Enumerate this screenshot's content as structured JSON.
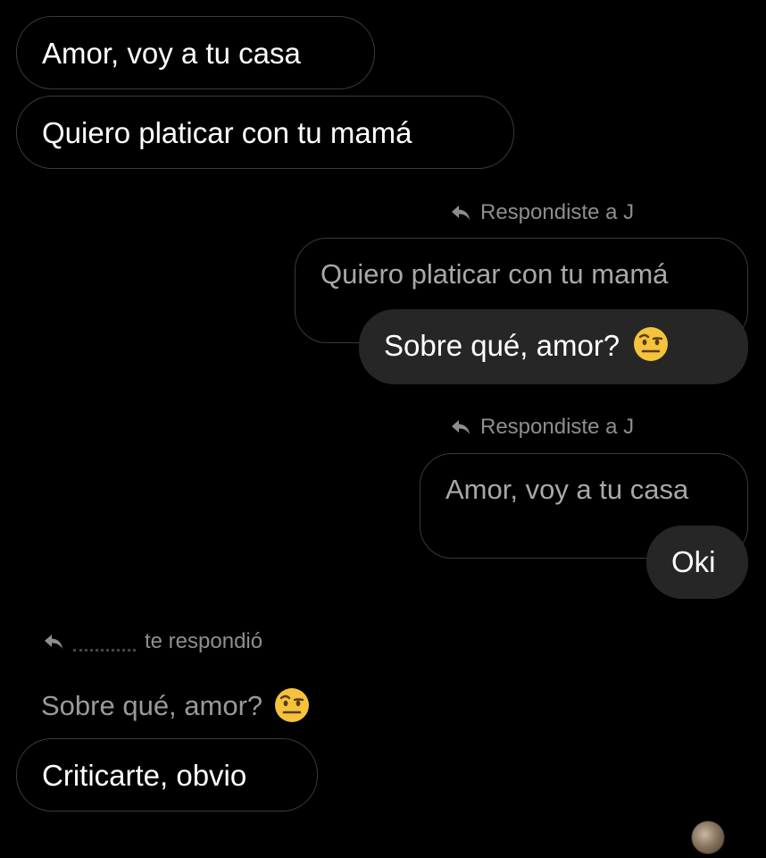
{
  "conversation": {
    "msg1": {
      "text": "Amor, voy a tu casa"
    },
    "msg2": {
      "text": "Quiero platicar con tu mamá"
    },
    "reply1": {
      "label": "Respondiste a J",
      "quoted": "Quiero platicar con tu mamá",
      "text": "Sobre qué, amor?",
      "emoji": "raised-eyebrow-emoji"
    },
    "reply2": {
      "label": "Respondiste a J",
      "quoted": "Amor, voy a tu casa",
      "text": "Oki"
    },
    "reply3": {
      "label": "te respondió",
      "quoted": "Sobre qué, amor?",
      "emoji": "raised-eyebrow-emoji",
      "text": "Criticarte, obvio"
    }
  },
  "colors": {
    "background": "#000000",
    "sent_bubble": "#262626",
    "outline": "#3a3a3a",
    "secondary_text": "#8e8e8e"
  }
}
